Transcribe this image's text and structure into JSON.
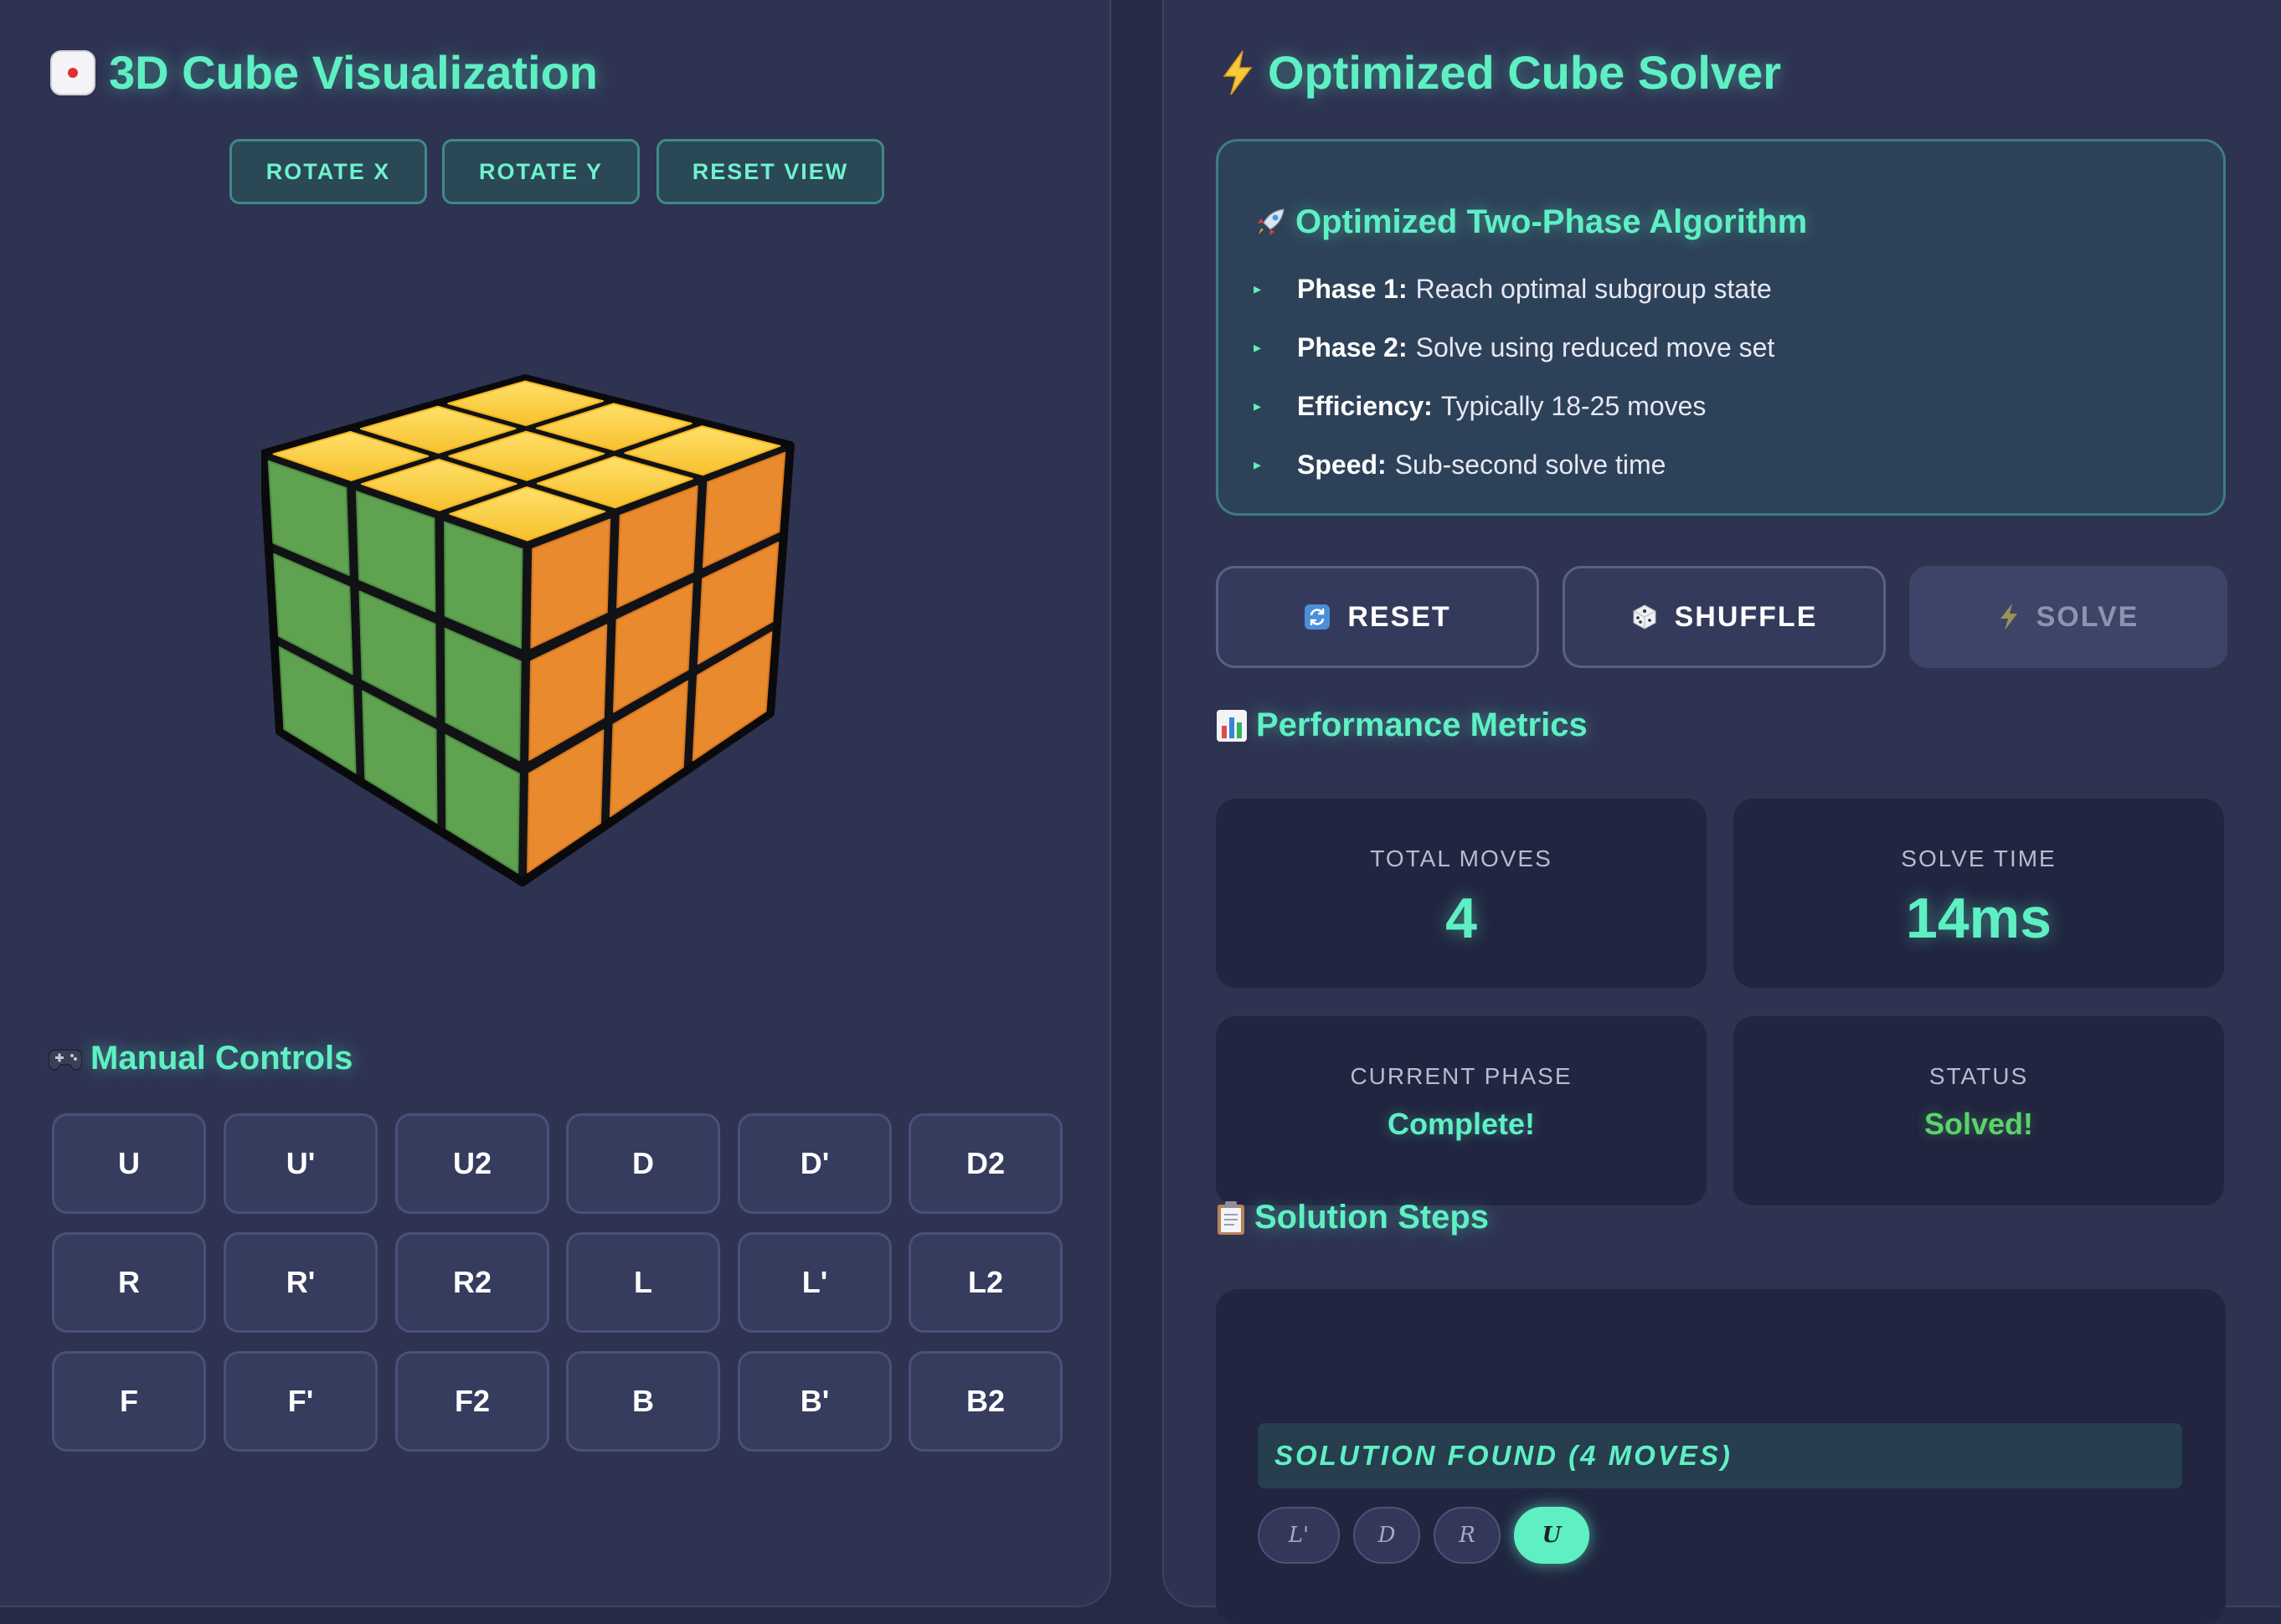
{
  "visualization": {
    "title": "3D Cube Visualization",
    "title_icon": "dice-icon",
    "view_buttons": [
      "ROTATE X",
      "ROTATE Y",
      "RESET VIEW"
    ],
    "cube_faces": {
      "top": "#ffcf3f",
      "left": "#5fa24f",
      "right": "#ea8a2e"
    }
  },
  "manual_controls": {
    "title": "Manual Controls",
    "title_icon": "gamepad-icon",
    "moves": [
      [
        "U",
        "U'",
        "U2",
        "D",
        "D'",
        "D2"
      ],
      [
        "R",
        "R'",
        "R2",
        "L",
        "L'",
        "L2"
      ],
      [
        "F",
        "F'",
        "F2",
        "B",
        "B'",
        "B2"
      ]
    ]
  },
  "solver": {
    "title": "Optimized Cube Solver",
    "title_icon": "lightning-icon",
    "algorithm": {
      "title": "Optimized Two-Phase Algorithm",
      "title_icon": "rocket-icon",
      "items": [
        {
          "label": "Phase 1:",
          "text": "Reach optimal subgroup state"
        },
        {
          "label": "Phase 2:",
          "text": "Solve using reduced move set"
        },
        {
          "label": "Efficiency:",
          "text": "Typically 18-25 moves"
        },
        {
          "label": "Speed:",
          "text": "Sub-second solve time"
        }
      ]
    },
    "actions": {
      "reset": "RESET",
      "shuffle": "SHUFFLE",
      "solve": "SOLVE"
    }
  },
  "performance": {
    "title": "Performance Metrics",
    "title_icon": "bar-chart-icon",
    "total_moves_label": "TOTAL MOVES",
    "total_moves": "4",
    "solve_time_label": "SOLVE TIME",
    "solve_time": "14ms",
    "phase_label": "CURRENT PHASE",
    "phase": "Complete!",
    "status_label": "STATUS",
    "status": "Solved!"
  },
  "solution": {
    "title": "Solution Steps",
    "title_icon": "clipboard-icon",
    "banner": "SOLUTION FOUND (4 MOVES)",
    "moves": [
      "L'",
      "D",
      "R",
      "U"
    ],
    "active_index": 3
  },
  "colors": {
    "accent": "#5ef0c3",
    "background": "#262b45",
    "panel": "#2e3352",
    "status_ok": "#5bd36a"
  }
}
